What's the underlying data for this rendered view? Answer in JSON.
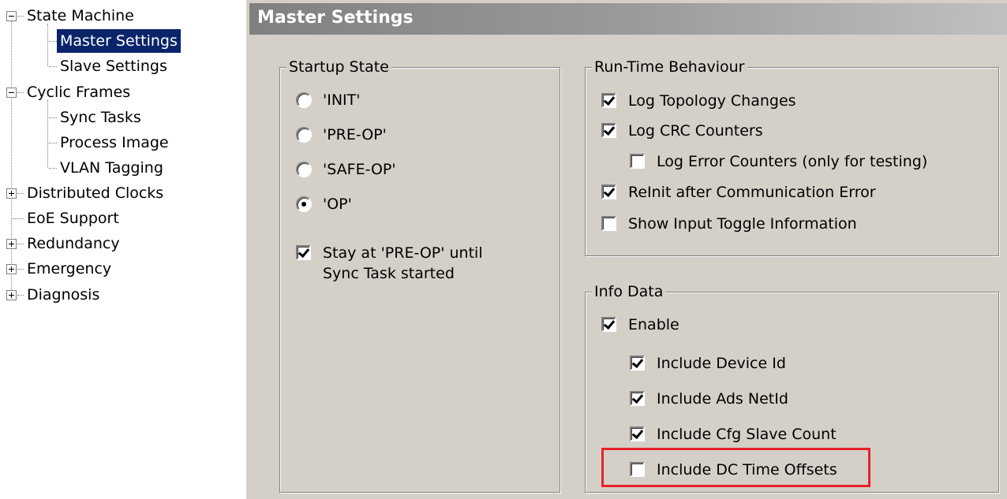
{
  "tree": {
    "items": [
      {
        "label": "State Machine",
        "expander": "minus"
      },
      {
        "label": "Master Settings",
        "selected": true
      },
      {
        "label": "Slave Settings"
      },
      {
        "label": "Cyclic Frames",
        "expander": "minus"
      },
      {
        "label": "Sync Tasks"
      },
      {
        "label": "Process Image"
      },
      {
        "label": "VLAN Tagging"
      },
      {
        "label": "Distributed Clocks",
        "expander": "plus"
      },
      {
        "label": "EoE Support"
      },
      {
        "label": "Redundancy",
        "expander": "plus"
      },
      {
        "label": "Emergency",
        "expander": "plus"
      },
      {
        "label": "Diagnosis",
        "expander": "plus"
      }
    ]
  },
  "header": {
    "title": "Master Settings"
  },
  "startup": {
    "title": "Startup State",
    "options": [
      "'INIT'",
      "'PRE-OP'",
      "'SAFE-OP'",
      "'OP'"
    ],
    "selected": "'OP'",
    "stay_label": "Stay at 'PRE-OP' until Sync Task started",
    "stay_line1": "Stay at 'PRE-OP' until",
    "stay_line2": "Sync Task started",
    "stay_checked": true
  },
  "runtime": {
    "title": "Run-Time Behaviour",
    "items": [
      {
        "label": "Log Topology Changes",
        "checked": true
      },
      {
        "label": "Log CRC Counters",
        "checked": true
      },
      {
        "label": "Log Error Counters (only for testing)",
        "checked": false
      },
      {
        "label": "ReInit after Communication Error",
        "checked": true
      },
      {
        "label": "Show Input Toggle Information",
        "checked": false
      }
    ]
  },
  "info": {
    "title": "Info Data",
    "items": [
      {
        "label": "Enable",
        "checked": true
      },
      {
        "label": "Include Device Id",
        "checked": true
      },
      {
        "label": "Include Ads NetId",
        "checked": true
      },
      {
        "label": "Include Cfg Slave Count",
        "checked": true
      },
      {
        "label": "Include DC Time Offsets",
        "checked": false
      }
    ]
  },
  "colors": {
    "highlight": "#e8202a",
    "selection": "#0a246a",
    "panel": "#d4d0c8"
  }
}
